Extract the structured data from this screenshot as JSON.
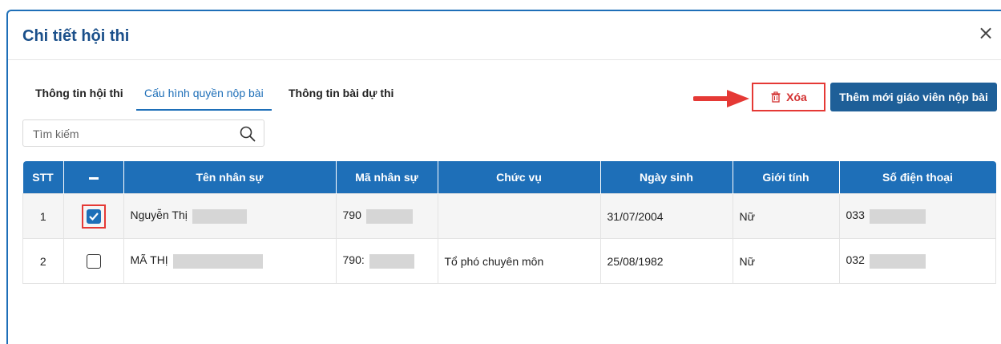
{
  "modal": {
    "title": "Chi tiết hội thi",
    "close_label": "×"
  },
  "tabs": [
    {
      "label": "Thông tin hội thi",
      "active": false
    },
    {
      "label": "Cấu hình quyền nộp bài",
      "active": true
    },
    {
      "label": "Thông tin bài dự thi",
      "active": false
    }
  ],
  "search": {
    "placeholder": "Tìm kiếm",
    "value": ""
  },
  "toolbar": {
    "delete_label": "Xóa",
    "add_label": "Thêm mới giáo viên nộp bài"
  },
  "table": {
    "headers": {
      "stt": "STT",
      "name": "Tên nhân sự",
      "code": "Mã nhân sự",
      "position": "Chức vụ",
      "birthdate": "Ngày sinh",
      "gender": "Giới tính",
      "phone": "Số điện thoại"
    },
    "rows": [
      {
        "stt": "1",
        "checked": true,
        "name": "Nguyễn Thị",
        "code": "790",
        "position": "",
        "birthdate": "31/07/2004",
        "gender": "Nữ",
        "phone": "033"
      },
      {
        "stt": "2",
        "checked": false,
        "name": "MÃ THỊ",
        "code": "790:",
        "position": "Tổ phó chuyên môn",
        "birthdate": "25/08/1982",
        "gender": "Nữ",
        "phone": "032"
      }
    ]
  },
  "colors": {
    "primary": "#1e6fb8",
    "title": "#1a4f8a",
    "highlight": "#e53935"
  }
}
